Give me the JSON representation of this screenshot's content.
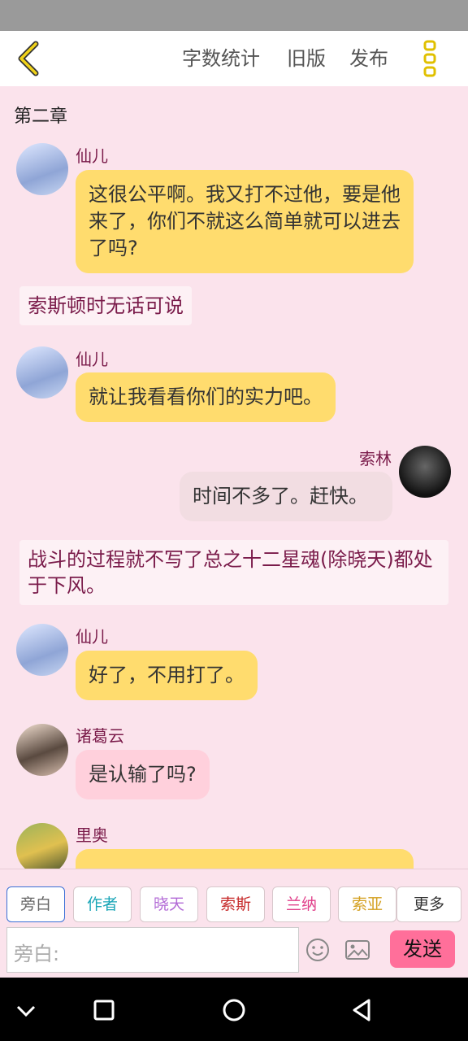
{
  "toolbar": {
    "word_count": "字数统计",
    "old_version": "旧版",
    "publish": "发布",
    "accent_color": "#e0c000"
  },
  "chapter_title": "第二章",
  "messages": [
    {
      "type": "left",
      "name": "仙儿",
      "text": "这很公平啊。我又打不过他，要是他来了，你们不就这么简单就可以进去了吗?",
      "bubble": "yellow"
    },
    {
      "type": "narration",
      "text": "索斯顿时无话可说"
    },
    {
      "type": "left",
      "name": "仙儿",
      "text": "就让我看看你们的实力吧。",
      "bubble": "yellow"
    },
    {
      "type": "right",
      "name": "索林",
      "text": "时间不多了。赶快。",
      "bubble": "grey"
    },
    {
      "type": "narration",
      "text": "战斗的过程就不写了总之十二星魂(除晓天)都处于下风。"
    },
    {
      "type": "left",
      "name": "仙儿",
      "text": "好了，不用打了。",
      "bubble": "yellow"
    },
    {
      "type": "left",
      "name": "诸葛云",
      "text": "是认输了吗?",
      "bubble": "pink"
    },
    {
      "type": "left",
      "name": "里奥",
      "text": "…",
      "bubble": "yellow"
    }
  ],
  "roles": [
    {
      "label": "旁白",
      "color": "#666666"
    },
    {
      "label": "作者",
      "color": "#1aa6b7"
    },
    {
      "label": "晓天",
      "color": "#b26ad6"
    },
    {
      "label": "索斯",
      "color": "#c62828"
    },
    {
      "label": "兰纳",
      "color": "#e0408a"
    },
    {
      "label": "索亚",
      "color": "#d4a020"
    },
    {
      "label": "更多",
      "color": "#333333"
    }
  ],
  "input": {
    "placeholder": "旁白:"
  },
  "send_label": "发送"
}
